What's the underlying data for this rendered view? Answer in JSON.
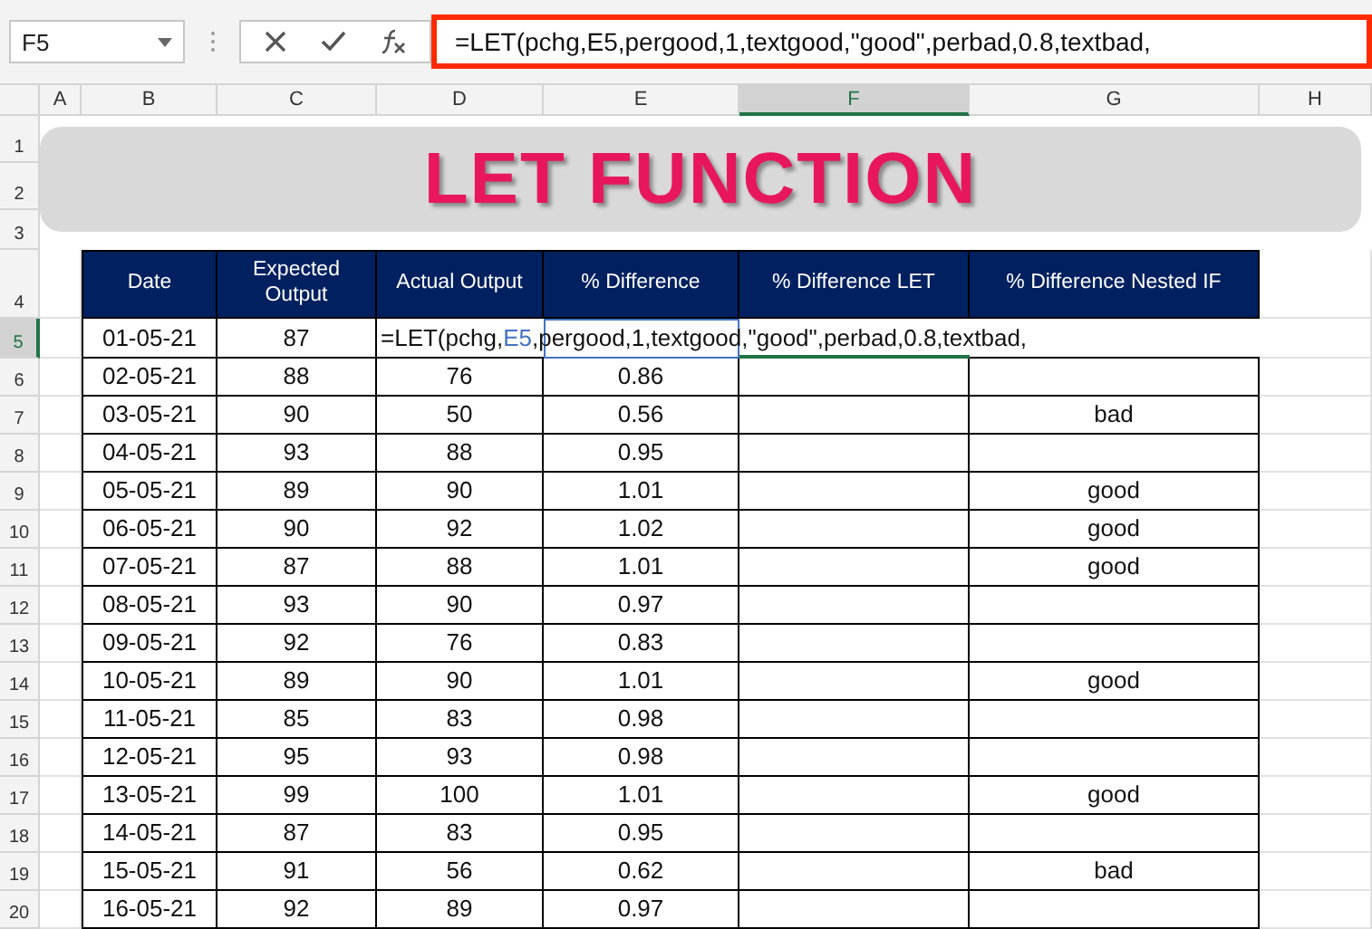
{
  "name_box": {
    "value": "F5"
  },
  "formula_bar": {
    "value": "=LET(pchg,E5,pergood,1,textgood,\"good\",perbad,0.8,textbad,",
    "highlighted": true
  },
  "column_headers": [
    {
      "label": "A",
      "selected": false
    },
    {
      "label": "B",
      "selected": false
    },
    {
      "label": "C",
      "selected": false
    },
    {
      "label": "D",
      "selected": false
    },
    {
      "label": "E",
      "selected": false
    },
    {
      "label": "F",
      "selected": true
    },
    {
      "label": "G",
      "selected": false
    },
    {
      "label": "H",
      "selected": false
    }
  ],
  "row_headers": [
    {
      "label": "1",
      "selected": false
    },
    {
      "label": "2",
      "selected": false
    },
    {
      "label": "3",
      "selected": false
    },
    {
      "label": "4",
      "selected": false
    },
    {
      "label": "5",
      "selected": true
    },
    {
      "label": "6",
      "selected": false
    },
    {
      "label": "7",
      "selected": false
    },
    {
      "label": "8",
      "selected": false
    },
    {
      "label": "9",
      "selected": false
    },
    {
      "label": "10",
      "selected": false
    },
    {
      "label": "11",
      "selected": false
    },
    {
      "label": "12",
      "selected": false
    },
    {
      "label": "13",
      "selected": false
    },
    {
      "label": "14",
      "selected": false
    },
    {
      "label": "15",
      "selected": false
    },
    {
      "label": "16",
      "selected": false
    },
    {
      "label": "17",
      "selected": false
    },
    {
      "label": "18",
      "selected": false
    },
    {
      "label": "19",
      "selected": false
    },
    {
      "label": "20",
      "selected": false
    }
  ],
  "title": "LET FUNCTION",
  "table": {
    "columns": [
      "Date",
      "Expected Output",
      "Actual Output",
      "% Difference",
      "% Difference LET",
      "% Difference Nested IF"
    ],
    "rows": [
      {
        "kind": "editing",
        "date": "01-05-21",
        "expected": "87",
        "edit": {
          "before": "=LET(pchg,",
          "reference": "E5",
          "after": ",pergood,1,textgood,\"good\",perbad,0.8,textbad,"
        }
      },
      {
        "kind": "data",
        "date": "02-05-21",
        "expected": "88",
        "actual": "76",
        "difference": "0.86"
      },
      {
        "kind": "data",
        "date": "03-05-21",
        "expected": "90",
        "actual": "50",
        "difference": "0.56",
        "nested_if": "bad"
      },
      {
        "kind": "data",
        "date": "04-05-21",
        "expected": "93",
        "actual": "88",
        "difference": "0.95"
      },
      {
        "kind": "data",
        "date": "05-05-21",
        "expected": "89",
        "actual": "90",
        "difference": "1.01",
        "nested_if": "good"
      },
      {
        "kind": "data",
        "date": "06-05-21",
        "expected": "90",
        "actual": "92",
        "difference": "1.02",
        "nested_if": "good"
      },
      {
        "kind": "data",
        "date": "07-05-21",
        "expected": "87",
        "actual": "88",
        "difference": "1.01",
        "nested_if": "good"
      },
      {
        "kind": "data",
        "date": "08-05-21",
        "expected": "93",
        "actual": "90",
        "difference": "0.97"
      },
      {
        "kind": "data",
        "date": "09-05-21",
        "expected": "92",
        "actual": "76",
        "difference": "0.83"
      },
      {
        "kind": "data",
        "date": "10-05-21",
        "expected": "89",
        "actual": "90",
        "difference": "1.01",
        "nested_if": "good"
      },
      {
        "kind": "data",
        "date": "11-05-21",
        "expected": "85",
        "actual": "83",
        "difference": "0.98"
      },
      {
        "kind": "data",
        "date": "12-05-21",
        "expected": "95",
        "actual": "93",
        "difference": "0.98"
      },
      {
        "kind": "data",
        "date": "13-05-21",
        "expected": "99",
        "actual": "100",
        "difference": "1.01",
        "nested_if": "good"
      },
      {
        "kind": "data",
        "date": "14-05-21",
        "expected": "87",
        "actual": "83",
        "difference": "0.95"
      },
      {
        "kind": "data",
        "date": "15-05-21",
        "expected": "91",
        "actual": "56",
        "difference": "0.62",
        "nested_if": "bad"
      },
      {
        "kind": "data",
        "date": "16-05-21",
        "expected": "92",
        "actual": "89",
        "difference": "0.97"
      }
    ]
  }
}
